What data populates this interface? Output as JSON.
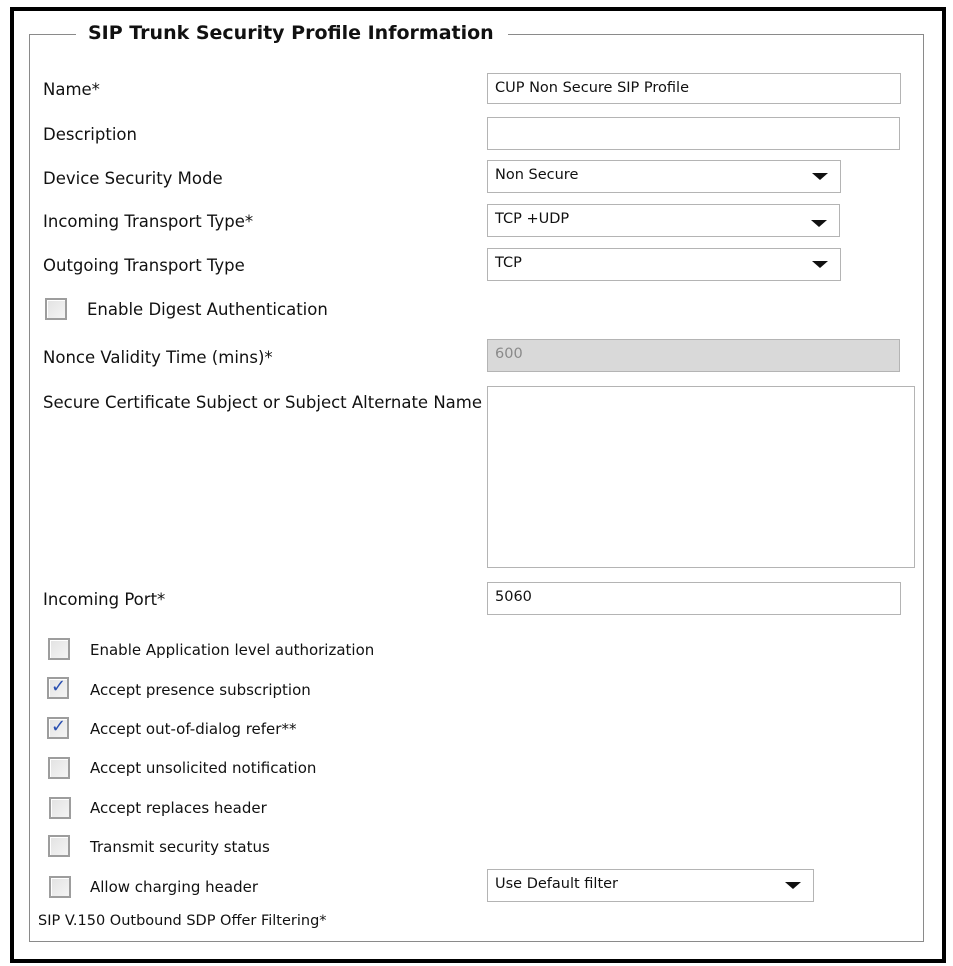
{
  "section_title": "SIP Trunk Security Profile Information",
  "fields": {
    "name": {
      "label": "Name*",
      "value": "CUP Non Secure SIP Profile"
    },
    "description": {
      "label": "Description",
      "value": ""
    },
    "device_security_mode": {
      "label": "Device Security Mode",
      "value": "Non Secure"
    },
    "incoming_transport_type": {
      "label": "Incoming Transport Type*",
      "value": "TCP +UDP"
    },
    "outgoing_transport_type": {
      "label": "Outgoing Transport Type",
      "value": "TCP"
    },
    "enable_digest_auth": {
      "label": "Enable Digest Authentication",
      "checked": false
    },
    "nonce_validity_time": {
      "label": "Nonce Validity Time (mins)*",
      "value": "600",
      "disabled": true
    },
    "secure_cert_subject": {
      "label": "Secure Certificate Subject or Subject Alternate Name",
      "value": ""
    },
    "incoming_port": {
      "label": "Incoming Port*",
      "value": "5060"
    },
    "sdp_offer_filtering": {
      "label": "SIP V.150 Outbound SDP Offer Filtering*",
      "value": "Use Default filter"
    }
  },
  "checkboxes": [
    {
      "label": "Enable Application level authorization",
      "checked": false
    },
    {
      "label": "Accept presence subscription",
      "checked": true
    },
    {
      "label": "Accept out-of-dialog refer**",
      "checked": true
    },
    {
      "label": "Accept unsolicited notification",
      "checked": false
    },
    {
      "label": "Accept replaces header",
      "checked": false
    },
    {
      "label": "Transmit security status",
      "checked": false
    },
    {
      "label": "Allow charging header",
      "checked": false
    }
  ],
  "icons": {
    "dropdown": "caret-down-icon",
    "check": "checkmark-icon"
  },
  "colors": {
    "checkmark": "#2a4fb0",
    "disabled_field": "#d9d9d9"
  }
}
